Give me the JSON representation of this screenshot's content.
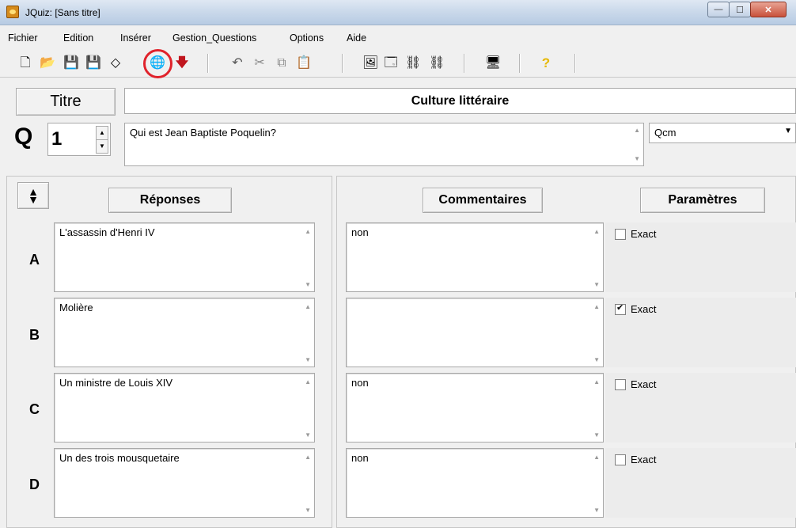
{
  "window": {
    "title": "JQuiz: [Sans titre]",
    "controls": {
      "minimize": "—",
      "maximize": "☐",
      "close": "✕"
    }
  },
  "menu": [
    "Fichier",
    "Edition",
    "Insérer",
    "Gestion_Questions",
    "Options",
    "Aide"
  ],
  "toolbar": {
    "buttons": [
      {
        "name": "new-file-icon",
        "glyph": "🗋"
      },
      {
        "name": "open-folder-icon",
        "glyph": "📂"
      },
      {
        "name": "save-icon",
        "glyph": "💾"
      },
      {
        "name": "save-as-icon",
        "glyph": "💾"
      },
      {
        "name": "eraser-icon",
        "glyph": "◇"
      },
      {
        "name": "globe-export-icon",
        "glyph": "🌐"
      },
      {
        "name": "arrow-down-icon",
        "glyph": "🡇"
      },
      {
        "name": "undo-icon",
        "glyph": "↶"
      },
      {
        "name": "cut-icon",
        "glyph": "✂"
      },
      {
        "name": "copy-icon",
        "glyph": "⧉"
      },
      {
        "name": "paste-icon",
        "glyph": "📋"
      },
      {
        "name": "image-icon",
        "glyph": "🖼"
      },
      {
        "name": "window-icon",
        "glyph": "🗔"
      },
      {
        "name": "network-icon",
        "glyph": "⛓"
      },
      {
        "name": "network-remove-icon",
        "glyph": "⛓"
      },
      {
        "name": "preview-icon",
        "glyph": "🖥"
      },
      {
        "name": "help-icon",
        "glyph": "?"
      }
    ]
  },
  "header": {
    "title_button": "Titre",
    "title_value": "Culture littéraire",
    "question_prefix": "Q",
    "question_number": "1",
    "question_text": "Qui est Jean Baptiste Poquelin?",
    "question_type": "Qcm"
  },
  "columns": {
    "answers": "Réponses",
    "comments": "Commentaires",
    "params": "Paramètres"
  },
  "answers": [
    {
      "letter": "A",
      "text": "L'assassin d'Henri IV",
      "comment": "non",
      "exact_label": "Exact",
      "exact": false
    },
    {
      "letter": "B",
      "text": "Molière",
      "comment": "",
      "exact_label": "Exact",
      "exact": true
    },
    {
      "letter": "C",
      "text": "Un ministre de Louis XIV",
      "comment": "non",
      "exact_label": "Exact",
      "exact": false
    },
    {
      "letter": "D",
      "text": "Un des trois mousquetaire",
      "comment": "non",
      "exact_label": "Exact",
      "exact": false
    }
  ],
  "colors": {
    "highlight_circle": "#e0222b",
    "help_icon": "#e6b800",
    "arrow_icon": "#c0161e"
  }
}
